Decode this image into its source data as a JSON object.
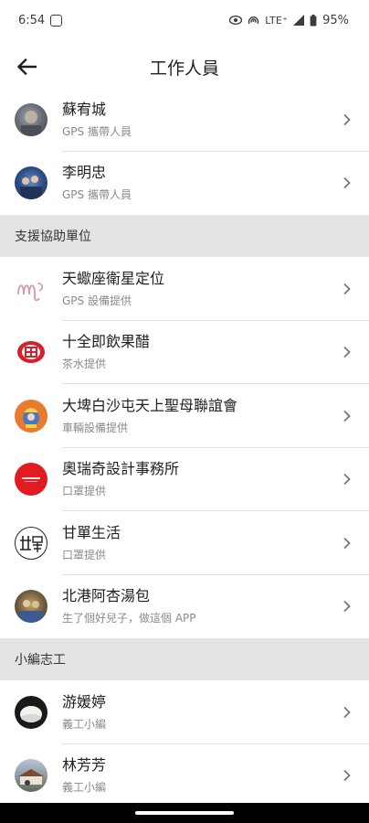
{
  "status_bar": {
    "time": "6:54",
    "network": "LTE⁺",
    "battery": "95%"
  },
  "header": {
    "title": "工作人員"
  },
  "groups": [
    {
      "items": [
        {
          "name": "蘇宥城",
          "role": "GPS 攜帶人員",
          "avatar_icon": "photo-avatar-icon"
        },
        {
          "name": "李明忠",
          "role": "GPS 攜帶人員",
          "avatar_icon": "photo-avatar-icon"
        }
      ]
    },
    {
      "header": "支援協助單位",
      "items": [
        {
          "name": "天蠍座衛星定位",
          "role": "GPS 設備提供",
          "avatar_icon": "scorpio-logo-icon"
        },
        {
          "name": "十全即飲果醋",
          "role": "茶水提供",
          "avatar_icon": "shiquan-logo-icon"
        },
        {
          "name": "大埤白沙屯天上聖母聯誼會",
          "role": "車輛設備提供",
          "avatar_icon": "temple-logo-icon"
        },
        {
          "name": "奧瑞奇設計事務所",
          "role": "口罩提供",
          "avatar_icon": "design-logo-icon"
        },
        {
          "name": "甘單生活",
          "role": "口罩提供",
          "avatar_icon": "gandan-logo-icon"
        },
        {
          "name": "北港阿杏湯包",
          "role": "生了個好兒子，做這個 APP",
          "avatar_icon": "photo-avatar-icon"
        }
      ]
    },
    {
      "header": "小編志工",
      "items": [
        {
          "name": "游媛婷",
          "role": "義工小編",
          "avatar_icon": "photo-avatar-icon"
        },
        {
          "name": "林芳芳",
          "role": "義工小編",
          "avatar_icon": "photo-avatar-icon"
        }
      ]
    }
  ],
  "colors": {
    "section_bg": "#e4e4e6",
    "divider": "#e3e3e3",
    "subtitle": "#8a8a8a"
  }
}
